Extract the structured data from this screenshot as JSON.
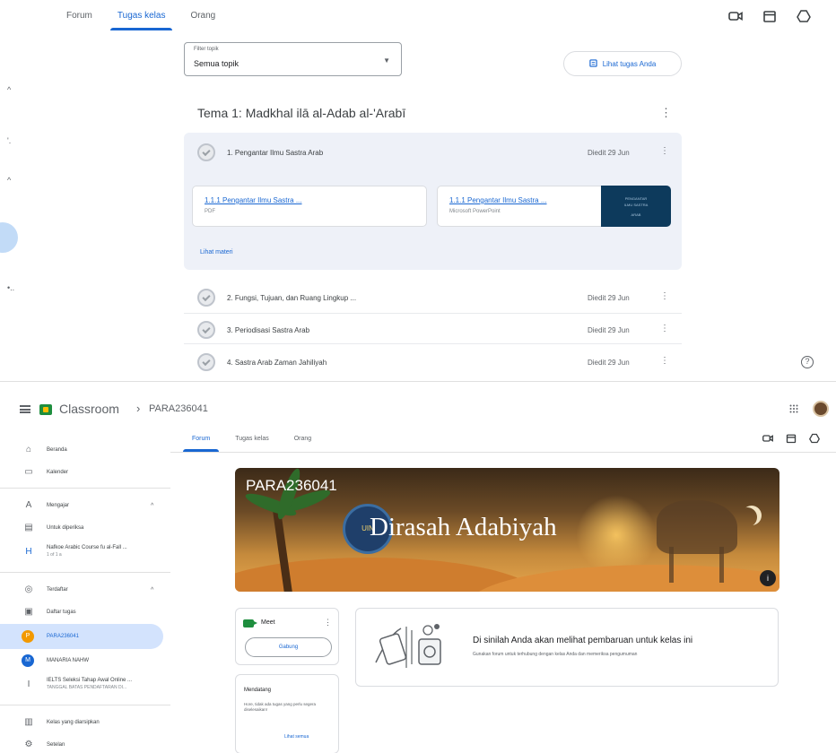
{
  "top": {
    "tabs": [
      {
        "label": "Forum",
        "active": false
      },
      {
        "label": "Tugas kelas",
        "active": true
      },
      {
        "label": "Orang",
        "active": false
      }
    ],
    "toolbar_icons": [
      "meet-icon",
      "calendar-icon",
      "drive-icon"
    ],
    "rail_marks": [
      "^",
      "'.",
      "^",
      "•.."
    ],
    "filter": {
      "label": "Filter topik",
      "value": "Semua topik"
    },
    "view_tasks_button": "Lihat tugas Anda",
    "topic": {
      "title": "Tema 1: Madkhal ilā al-Adab al-'Arabī"
    },
    "expanded_item": {
      "title": "1. Pengantar Ilmu Sastra Arab",
      "date": "Diedit 29 Jun",
      "attachments": [
        {
          "title": "1.1.1 Pengantar Ilmu Sastra ...",
          "sub": "PDF"
        },
        {
          "title": "1.1.1 Pengantar Ilmu Sastra ...",
          "sub": "Microsoft PowerPoint",
          "thumb_lines": [
            "PENGANTAR",
            "ILMU SASTRA",
            "ARAB"
          ]
        }
      ],
      "see_material": "Lihat materi"
    },
    "items": [
      {
        "title": "2. Fungsi, Tujuan, dan Ruang Lingkup ...",
        "date": "Diedit 29 Jun"
      },
      {
        "title": "3. Periodisasi Sastra Arab",
        "date": "Diedit 29 Jun"
      },
      {
        "title": "4. Sastra Arab Zaman Jahiliyah",
        "date": "Diedit 29 Jun"
      }
    ],
    "help_glyph": "?"
  },
  "bottom": {
    "app_title": "Classroom",
    "crumb_sep": "›",
    "crumb": "PARA236041",
    "tabs": [
      {
        "label": "Forum",
        "active": true
      },
      {
        "label": "Tugas kelas",
        "active": false
      },
      {
        "label": "Orang",
        "active": false
      }
    ],
    "sidebar": [
      {
        "icon": "⌂",
        "label": "Beranda"
      },
      {
        "icon": "▭",
        "label": "Kalender"
      },
      {
        "icon": "A",
        "label": "Mengajar",
        "chev": "^"
      },
      {
        "icon": "▤",
        "label": "Untuk diperiksa"
      },
      {
        "icon": "H",
        "label": "Nafkoe Arabic Course fu al-Fall ...",
        "sub": "1 of 1 a"
      },
      {
        "icon": "◎",
        "label": "Terdaftar",
        "chev": "^"
      },
      {
        "icon": "▣",
        "label": "Daftar tugas"
      },
      {
        "icon": "P",
        "label": "PARA236041",
        "active": true
      },
      {
        "icon": "M",
        "label": "MANARIA NAHW"
      },
      {
        "icon": "I",
        "label": "IELTS Seleksi Tahap Awal Online ...",
        "sub": "TANGGAL BATAS PENDAFTARAN DI..."
      },
      {
        "icon": "▥",
        "label": "Kelas yang diarsipkan"
      },
      {
        "icon": "⚙",
        "label": "Setelan"
      }
    ],
    "banner": {
      "code": "PARA236041",
      "name": "Dirasah Adabiyah",
      "emblem": "UIN",
      "info": "i"
    },
    "meet": {
      "label": "Meet",
      "join": "Gabung"
    },
    "upcoming": {
      "title": "Mendatang",
      "body": "Hore, tidak ada tugas yang perlu segera diselesaikan!",
      "link": "Lihat semua"
    },
    "stream": {
      "title": "Di sinilah Anda akan melihat pembaruan untuk kelas ini",
      "sub": "Gunakan forum untuk terhubung dengan kelas Anda dan memeriksa pengumuman"
    }
  },
  "colors": {
    "accent": "#1967d2",
    "active_bg": "#d3e3fd",
    "expanded_bg": "#eef1f8",
    "logo_green": "#1e8e3e",
    "logo_yellow": "#fbbc04"
  }
}
